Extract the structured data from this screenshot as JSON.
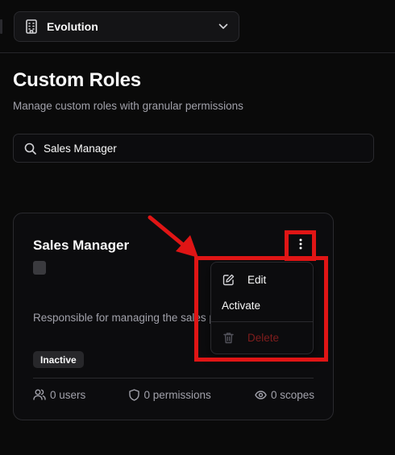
{
  "header": {
    "org_icon": "building-icon",
    "org_name": "Evolution",
    "chevron_icon": "chevron-down-icon"
  },
  "page": {
    "title": "Custom Roles",
    "subtitle": "Manage custom roles with granular permissions"
  },
  "search": {
    "icon": "search-icon",
    "value": "Sales Manager",
    "placeholder": ""
  },
  "role_card": {
    "title": "Sales Manager",
    "description": "Responsible for managing the sales performance, setting goals, analyzin",
    "status": "Inactive",
    "stats": {
      "users": "0 users",
      "permissions": "0 permissions",
      "scopes": "0 scopes"
    }
  },
  "menu": {
    "edit_label": "Edit",
    "activate_label": "Activate",
    "delete_label": "Delete"
  },
  "annotation": {
    "highlight_color": "#e01515"
  },
  "colors": {
    "background": "#0a0a0a",
    "muted_text": "#a1a1aa",
    "danger_text": "#7f1d1d"
  }
}
